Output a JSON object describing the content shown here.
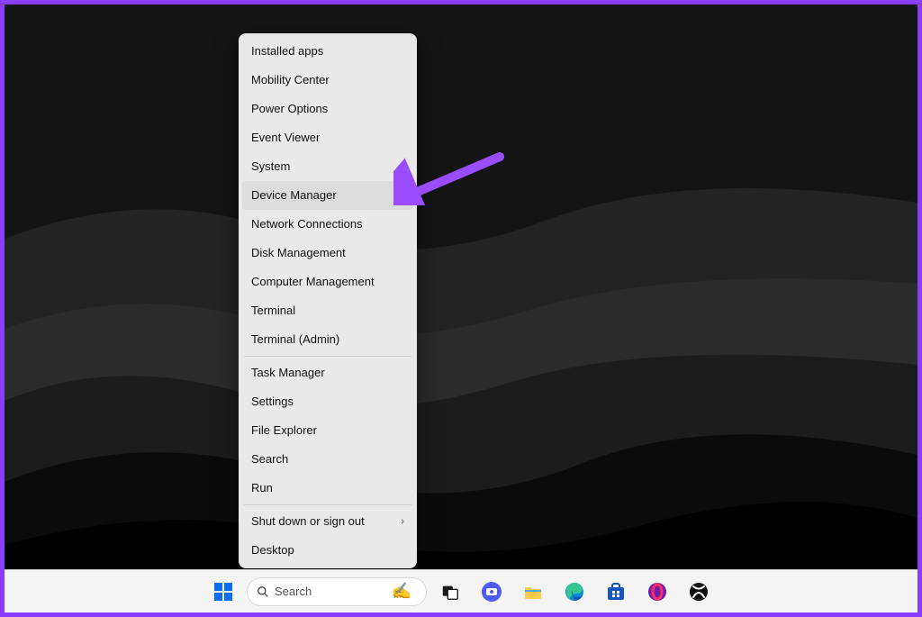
{
  "annotation_arrow_color": "#9a4dff",
  "context_menu": {
    "groups": [
      {
        "items": [
          {
            "label": "Installed apps",
            "submenu": false,
            "highlight": false
          },
          {
            "label": "Mobility Center",
            "submenu": false,
            "highlight": false
          },
          {
            "label": "Power Options",
            "submenu": false,
            "highlight": false
          },
          {
            "label": "Event Viewer",
            "submenu": false,
            "highlight": false
          },
          {
            "label": "System",
            "submenu": false,
            "highlight": false
          },
          {
            "label": "Device Manager",
            "submenu": false,
            "highlight": true
          },
          {
            "label": "Network Connections",
            "submenu": false,
            "highlight": false
          },
          {
            "label": "Disk Management",
            "submenu": false,
            "highlight": false
          },
          {
            "label": "Computer Management",
            "submenu": false,
            "highlight": false
          },
          {
            "label": "Terminal",
            "submenu": false,
            "highlight": false
          },
          {
            "label": "Terminal (Admin)",
            "submenu": false,
            "highlight": false
          }
        ]
      },
      {
        "items": [
          {
            "label": "Task Manager",
            "submenu": false,
            "highlight": false
          },
          {
            "label": "Settings",
            "submenu": false,
            "highlight": false
          },
          {
            "label": "File Explorer",
            "submenu": false,
            "highlight": false
          },
          {
            "label": "Search",
            "submenu": false,
            "highlight": false
          },
          {
            "label": "Run",
            "submenu": false,
            "highlight": false
          }
        ]
      },
      {
        "items": [
          {
            "label": "Shut down or sign out",
            "submenu": true,
            "highlight": false
          },
          {
            "label": "Desktop",
            "submenu": false,
            "highlight": false
          }
        ]
      }
    ]
  },
  "taskbar": {
    "search_placeholder": "Search",
    "pinned": [
      {
        "name": "start",
        "icon": "windows-logo-icon"
      },
      {
        "name": "search",
        "icon": "search-icon"
      },
      {
        "name": "task-view",
        "icon": "task-view-icon"
      },
      {
        "name": "chat",
        "icon": "chat-icon"
      },
      {
        "name": "file-explorer",
        "icon": "folder-icon"
      },
      {
        "name": "edge",
        "icon": "edge-icon"
      },
      {
        "name": "microsoft-store",
        "icon": "store-icon"
      },
      {
        "name": "opera",
        "icon": "opera-icon"
      },
      {
        "name": "xbox",
        "icon": "xbox-icon"
      }
    ]
  }
}
